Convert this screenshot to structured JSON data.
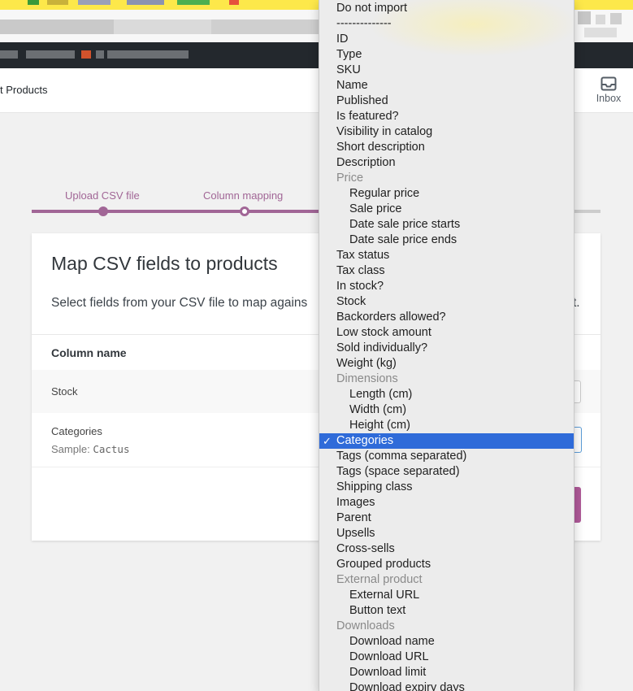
{
  "page": {
    "header_title": "t Products",
    "inbox_label": "Inbox"
  },
  "steps": {
    "items": [
      {
        "label": "Upload CSV file"
      },
      {
        "label": "Column mapping"
      }
    ]
  },
  "card": {
    "title": "Map CSV fields to products",
    "description": "Select fields from your CSV file to map agains",
    "description_tail": "t.",
    "column_header": "Column name",
    "rows": [
      {
        "name": "Stock"
      },
      {
        "name": "Categories",
        "sample_label": "Sample:",
        "sample_value": "Cactus"
      }
    ]
  },
  "dropdown": {
    "selected": "Categories",
    "check_glyph": "✓",
    "options": [
      {
        "label": "Do not import",
        "kind": "option"
      },
      {
        "label": "--------------",
        "kind": "option"
      },
      {
        "label": "ID",
        "kind": "option"
      },
      {
        "label": "Type",
        "kind": "option"
      },
      {
        "label": "SKU",
        "kind": "option"
      },
      {
        "label": "Name",
        "kind": "option"
      },
      {
        "label": "Published",
        "kind": "option"
      },
      {
        "label": "Is featured?",
        "kind": "option"
      },
      {
        "label": "Visibility in catalog",
        "kind": "option"
      },
      {
        "label": "Short description",
        "kind": "option"
      },
      {
        "label": "Description",
        "kind": "option"
      },
      {
        "label": "Price",
        "kind": "group"
      },
      {
        "label": "Regular price",
        "kind": "sub"
      },
      {
        "label": "Sale price",
        "kind": "sub"
      },
      {
        "label": "Date sale price starts",
        "kind": "sub"
      },
      {
        "label": "Date sale price ends",
        "kind": "sub"
      },
      {
        "label": "Tax status",
        "kind": "option"
      },
      {
        "label": "Tax class",
        "kind": "option"
      },
      {
        "label": "In stock?",
        "kind": "option"
      },
      {
        "label": "Stock",
        "kind": "option"
      },
      {
        "label": "Backorders allowed?",
        "kind": "option"
      },
      {
        "label": "Low stock amount",
        "kind": "option"
      },
      {
        "label": "Sold individually?",
        "kind": "option"
      },
      {
        "label": "Weight (kg)",
        "kind": "option"
      },
      {
        "label": "Dimensions",
        "kind": "group"
      },
      {
        "label": "Length (cm)",
        "kind": "sub"
      },
      {
        "label": "Width (cm)",
        "kind": "sub"
      },
      {
        "label": "Height (cm)",
        "kind": "sub"
      },
      {
        "label": "Categories",
        "kind": "option"
      },
      {
        "label": "Tags (comma separated)",
        "kind": "option"
      },
      {
        "label": "Tags (space separated)",
        "kind": "option"
      },
      {
        "label": "Shipping class",
        "kind": "option"
      },
      {
        "label": "Images",
        "kind": "option"
      },
      {
        "label": "Parent",
        "kind": "option"
      },
      {
        "label": "Upsells",
        "kind": "option"
      },
      {
        "label": "Cross-sells",
        "kind": "option"
      },
      {
        "label": "Grouped products",
        "kind": "option"
      },
      {
        "label": "External product",
        "kind": "group"
      },
      {
        "label": "External URL",
        "kind": "sub"
      },
      {
        "label": "Button text",
        "kind": "sub"
      },
      {
        "label": "Downloads",
        "kind": "group"
      },
      {
        "label": "Download name",
        "kind": "sub"
      },
      {
        "label": "Download URL",
        "kind": "sub"
      },
      {
        "label": "Download limit",
        "kind": "sub"
      },
      {
        "label": "Download expiry days",
        "kind": "sub"
      }
    ]
  },
  "colors": {
    "accent": "#a16696",
    "selection": "#2f6bd9",
    "focus_border": "#5b9dd9",
    "admin_bar": "#23282d",
    "browser_bar": "#fde84a"
  },
  "icons": {
    "inbox": "inbox-icon",
    "check": "checkmark-icon"
  }
}
